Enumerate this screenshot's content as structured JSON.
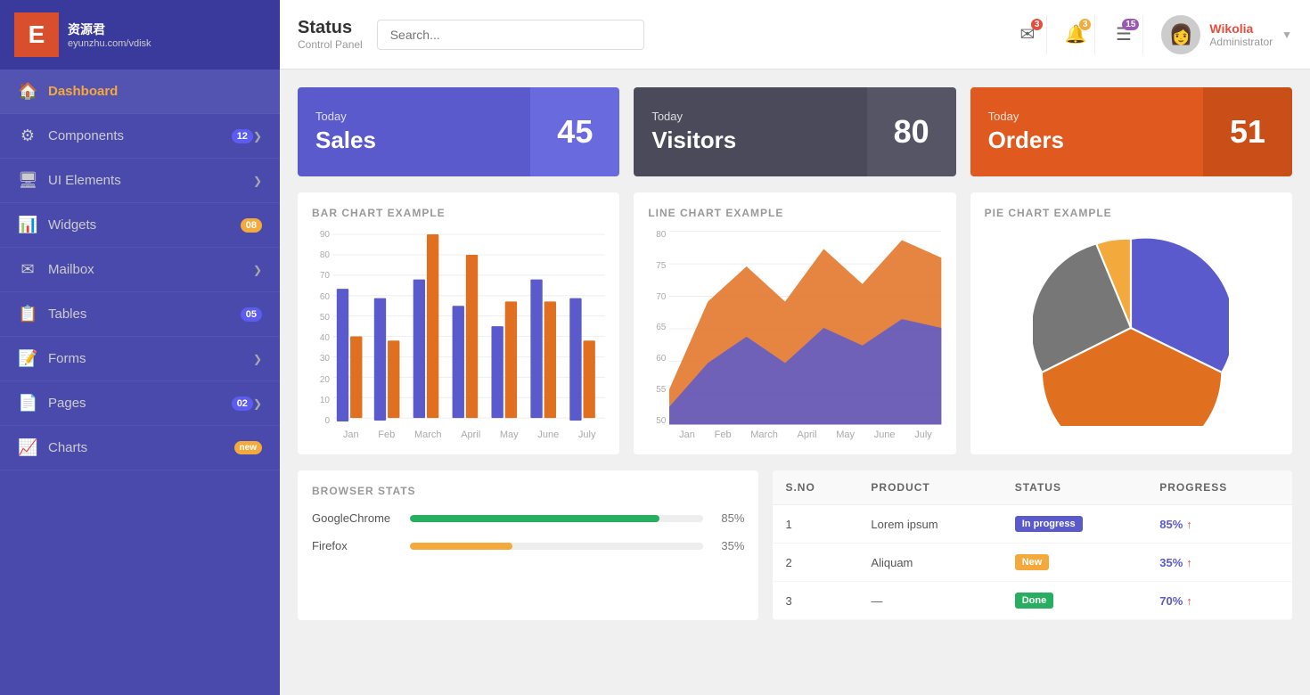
{
  "sidebar": {
    "logo": {
      "letter": "E",
      "title": "资源君",
      "subtitle": "eyunzhu.com/vdisk"
    },
    "items": [
      {
        "id": "dashboard",
        "label": "Dashboard",
        "icon": "🏠",
        "active": true,
        "badge": null,
        "arrow": false
      },
      {
        "id": "components",
        "label": "Components",
        "icon": "⚙",
        "active": false,
        "badge": "12",
        "badgeColor": "blue",
        "arrow": true
      },
      {
        "id": "ui-elements",
        "label": "UI Elements",
        "icon": "🖥",
        "active": false,
        "badge": null,
        "arrow": true
      },
      {
        "id": "widgets",
        "label": "Widgets",
        "icon": "📊",
        "active": false,
        "badge": "08",
        "badgeColor": "orange",
        "arrow": false
      },
      {
        "id": "mailbox",
        "label": "Mailbox",
        "icon": "✉",
        "active": false,
        "badge": null,
        "arrow": true
      },
      {
        "id": "tables",
        "label": "Tables",
        "icon": "📋",
        "active": false,
        "badge": "05",
        "badgeColor": "blue",
        "arrow": false
      },
      {
        "id": "forms",
        "label": "Forms",
        "icon": "📝",
        "active": false,
        "badge": null,
        "arrow": true
      },
      {
        "id": "pages",
        "label": "Pages",
        "icon": "📄",
        "active": false,
        "badge": "02",
        "badgeColor": "blue",
        "arrow": true
      },
      {
        "id": "charts",
        "label": "Charts",
        "icon": "📈",
        "active": false,
        "badge": "new",
        "badgeColor": "orange",
        "arrow": false
      }
    ]
  },
  "header": {
    "title": "Status",
    "subtitle": "Control Panel",
    "search_placeholder": "Search...",
    "icons": {
      "mail": {
        "badge": "3"
      },
      "bell": {
        "badge": "3"
      },
      "list": {
        "badge": "15"
      }
    },
    "user": {
      "name": "Wikolia",
      "role": "Administrator"
    }
  },
  "stats": [
    {
      "id": "sales",
      "today": "Today",
      "title": "Sales",
      "value": "45",
      "theme": "blue"
    },
    {
      "id": "visitors",
      "today": "Today",
      "title": "Visitors",
      "value": "80",
      "theme": "dark"
    },
    {
      "id": "orders",
      "today": "Today",
      "title": "Orders",
      "value": "51",
      "theme": "orange"
    }
  ],
  "bar_chart": {
    "title": "BAR CHART EXAMPLE",
    "y_labels": [
      "90",
      "80",
      "70",
      "60",
      "50",
      "40",
      "30",
      "20",
      "10",
      "0"
    ],
    "x_labels": [
      "Jan",
      "Feb",
      "March",
      "April",
      "May",
      "June",
      "July"
    ],
    "groups": [
      {
        "month": "Jan",
        "blue": 65,
        "orange": 40
      },
      {
        "month": "Feb",
        "blue": 60,
        "orange": 38
      },
      {
        "month": "March",
        "blue": 68,
        "orange": 90
      },
      {
        "month": "April",
        "blue": 55,
        "orange": 80
      },
      {
        "month": "May",
        "blue": 45,
        "orange": 57
      },
      {
        "month": "June",
        "blue": 68,
        "orange": 57
      },
      {
        "month": "July",
        "blue": 60,
        "orange": 38
      }
    ]
  },
  "line_chart": {
    "title": "LINE CHART EXAMPLE",
    "y_labels": [
      "80",
      "75",
      "70",
      "65",
      "60",
      "55",
      "50"
    ],
    "x_labels": [
      "Jan",
      "Feb",
      "March",
      "April",
      "May",
      "June",
      "July"
    ]
  },
  "pie_chart": {
    "title": "PIE CHART EXAMPLE",
    "segments": [
      {
        "label": "Blue",
        "value": 35,
        "color": "#5a5acd"
      },
      {
        "label": "Orange",
        "value": 40,
        "color": "#e07020"
      },
      {
        "label": "Gray",
        "value": 15,
        "color": "#777"
      },
      {
        "label": "Yellow",
        "value": 10,
        "color": "#f4a93d"
      }
    ]
  },
  "browser_stats": {
    "title": "BROWSER STATS",
    "items": [
      {
        "name": "GoogleChrome",
        "pct": 85,
        "color": "#27ae60"
      },
      {
        "name": "Firefox",
        "pct": 35,
        "color": "#f4a93d"
      }
    ]
  },
  "table": {
    "columns": [
      "S.NO",
      "PRODUCT",
      "STATUS",
      "PROGRESS"
    ],
    "rows": [
      {
        "sno": "1",
        "product": "Lorem ipsum",
        "status": "In progress",
        "status_class": "inprogress",
        "progress": "85%",
        "arrow": "↑"
      },
      {
        "sno": "2",
        "product": "Aliquam",
        "status": "New",
        "status_class": "new",
        "progress": "35%",
        "arrow": "↑"
      },
      {
        "sno": "3",
        "product": "...",
        "status": "Done",
        "status_class": "done",
        "progress": "70%",
        "arrow": "↑"
      }
    ]
  }
}
